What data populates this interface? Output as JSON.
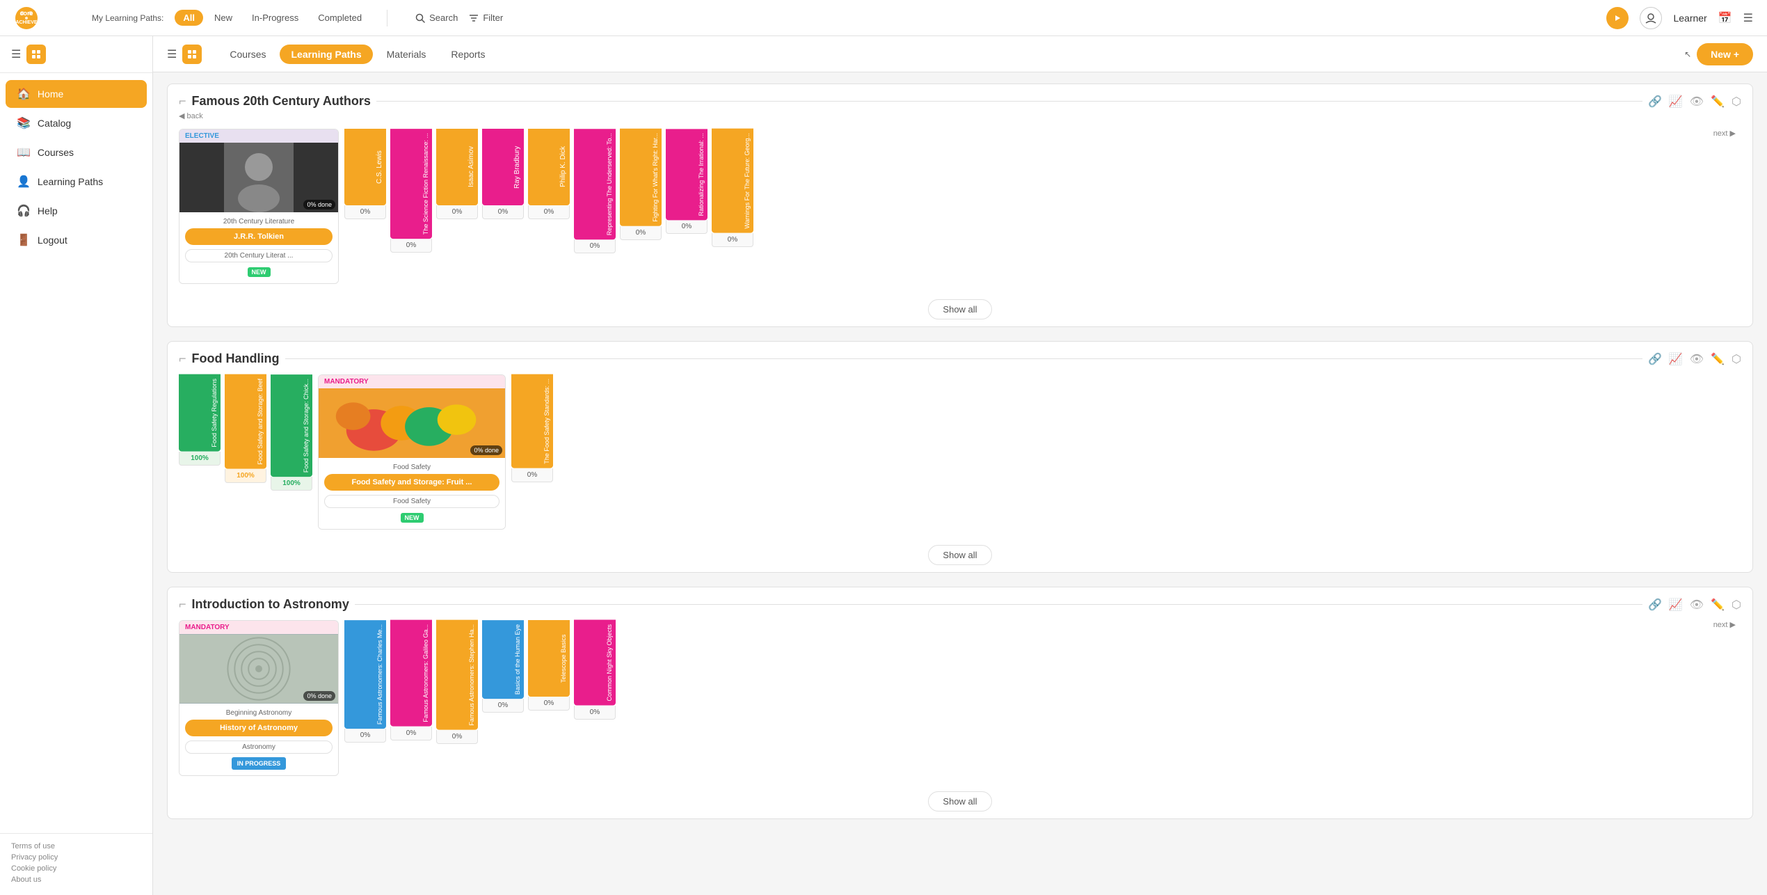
{
  "app": {
    "logo_text": "core\nACHIEVE",
    "logo_color": "#f5a623"
  },
  "topbar": {
    "my_paths_label": "My Learning Paths:",
    "tabs": [
      "All",
      "New",
      "In-Progress",
      "Completed"
    ],
    "active_tab": "All",
    "search_label": "Search",
    "filter_label": "Filter",
    "user_name": "Learner"
  },
  "subnav": {
    "tabs": [
      "Courses",
      "Learning Paths",
      "Materials",
      "Reports"
    ],
    "active_tab": "Learning Paths",
    "new_button": "New +"
  },
  "sidebar": {
    "items": [
      {
        "label": "Home",
        "icon": "🏠",
        "active": true
      },
      {
        "label": "Catalog",
        "icon": "📚",
        "active": false
      },
      {
        "label": "Courses",
        "icon": "📖",
        "active": false
      },
      {
        "label": "Learning Paths",
        "icon": "👤",
        "active": false
      },
      {
        "label": "Help",
        "icon": "🎧",
        "active": false
      },
      {
        "label": "Logout",
        "icon": "🚪",
        "active": false
      }
    ],
    "footer_links": [
      "Terms of use",
      "Privacy policy",
      "Cookie policy",
      "About us"
    ]
  },
  "sections": [
    {
      "id": "famous-authors",
      "title": "Famous 20th Century Authors",
      "nav": {
        "back": "back",
        "next": "next"
      },
      "featured": {
        "badge": "ELECTIVE",
        "badge_type": "elective",
        "category": "20th Century Literature",
        "author_name": "J.R.R. Tolkien",
        "subtitle": "20th Century Literat ...",
        "done_pct": "0%",
        "done_label": "done",
        "status": "NEW"
      },
      "courses": [
        {
          "title": "C.S. Lewis",
          "color": "bg-orange",
          "pct": "0%"
        },
        {
          "title": "The Science Fiction Renaissance: ...",
          "color": "bg-pink",
          "pct": "0%"
        },
        {
          "title": "Isaac Asimov",
          "color": "bg-orange",
          "pct": "0%"
        },
        {
          "title": "Ray Bradbury",
          "color": "bg-pink",
          "pct": "0%"
        },
        {
          "title": "Philip K. Dick",
          "color": "bg-orange",
          "pct": "0%"
        },
        {
          "title": "Representing The Underserved: To ...",
          "color": "bg-pink",
          "pct": "0%"
        },
        {
          "title": "Fighting For What's Right: Har ...",
          "color": "bg-orange",
          "pct": "0%"
        },
        {
          "title": "Rationalizing The Irrational: ...",
          "color": "bg-pink",
          "pct": "0%"
        },
        {
          "title": "Warnings For The Future: Georg ...",
          "color": "bg-orange",
          "pct": "0%"
        }
      ],
      "show_all_label": "Show all"
    },
    {
      "id": "food-handling",
      "title": "Food Handling",
      "featured": {
        "badge": "MANDATORY",
        "badge_type": "mandatory",
        "category": "Food Safety",
        "course_name": "Food Safety and Storage: Fruit ...",
        "subtitle": "Food Safety",
        "done_pct": "0%",
        "done_label": "done",
        "status": "NEW"
      },
      "courses": [
        {
          "title": "Food Safety Regulations",
          "color": "bg-green",
          "pct": "100%"
        },
        {
          "title": "Food Safety and Storage: Beef",
          "color": "bg-orange",
          "pct": "100%"
        },
        {
          "title": "Food Safety and Storage: Chick ...",
          "color": "bg-green",
          "pct": "100%"
        },
        {
          "title": "The Food Safety Standards: ...",
          "color": "bg-orange",
          "pct": "0%"
        }
      ],
      "show_all_label": "Show all"
    },
    {
      "id": "intro-astronomy",
      "title": "Introduction to Astronomy",
      "nav": {
        "next": "next"
      },
      "featured": {
        "badge": "MANDATORY",
        "badge_type": "mandatory",
        "category": "Beginning Astronomy",
        "course_name": "History of Astronomy",
        "subtitle": "Astronomy",
        "done_pct": "0%",
        "done_label": "done",
        "status": "IN PROGRESS",
        "status_type": "inprogress"
      },
      "courses": [
        {
          "title": "Famous Astronomers: Charles Me ...",
          "color": "bg-blue",
          "pct": "0%"
        },
        {
          "title": "Famous Astronomers: Galileo Ga ...",
          "color": "bg-pink",
          "pct": "0%"
        },
        {
          "title": "Famous Astronomers: Stephen Ha ...",
          "color": "bg-orange",
          "pct": "0%"
        },
        {
          "title": "Basics of the Human Eye",
          "color": "bg-blue",
          "pct": "0%"
        },
        {
          "title": "Telescope Basics",
          "color": "bg-orange",
          "pct": "0%"
        },
        {
          "title": "Common Night Sky Objects",
          "color": "bg-pink",
          "pct": "0%"
        }
      ],
      "show_all_label": "Show all"
    }
  ]
}
